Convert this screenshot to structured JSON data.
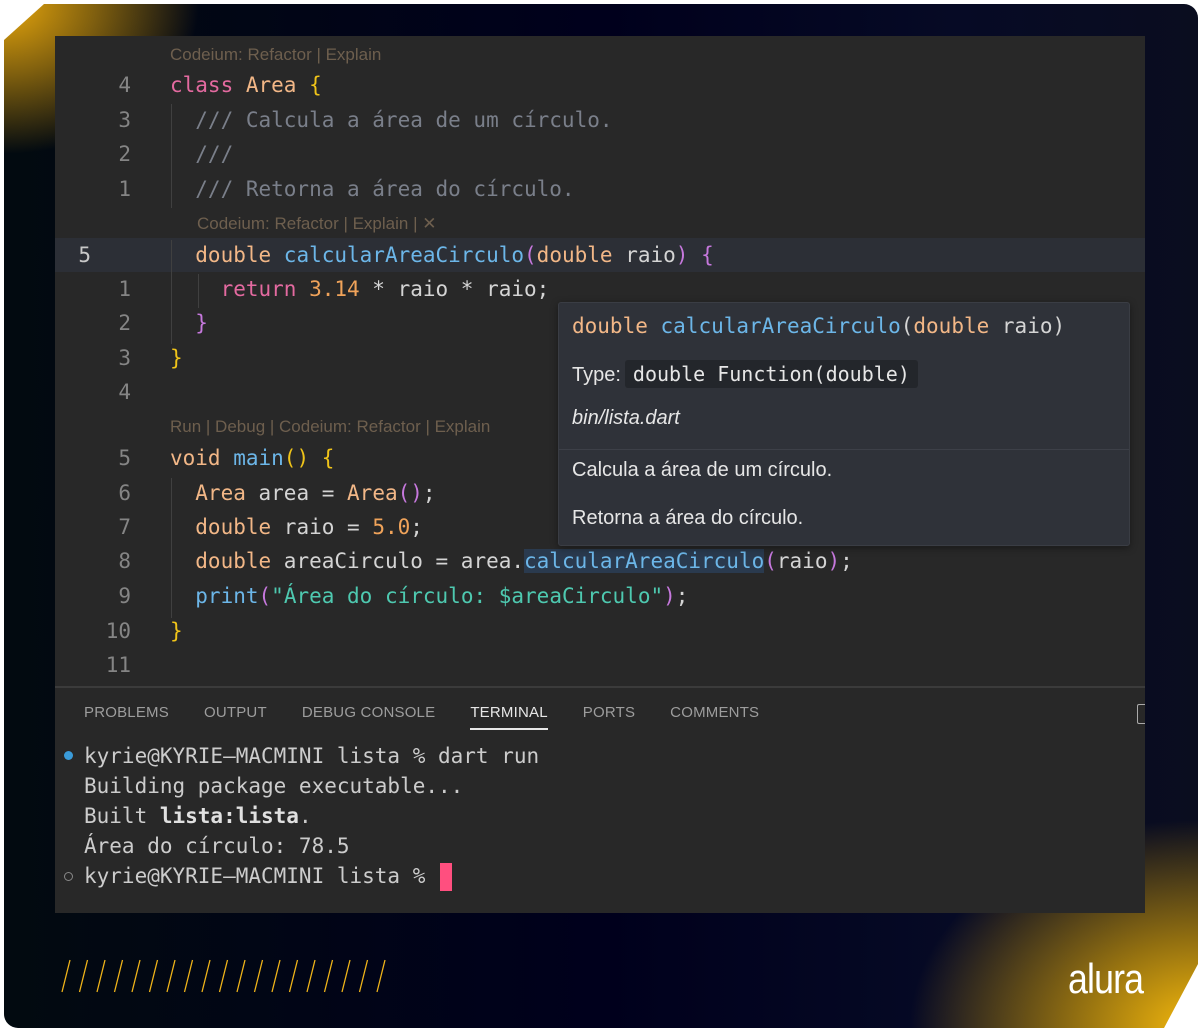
{
  "editor": {
    "codelens": {
      "class_lens": "Codeium: Refactor | Explain",
      "method_lens": "Codeium: Refactor | Explain | ✕",
      "main_lens": "Run | Debug | Codeium: Refactor | Explain"
    },
    "lines": [
      {
        "ln": "4",
        "tokens": [
          [
            "kw",
            "class "
          ],
          [
            "ty",
            "Area "
          ],
          [
            "br",
            "{"
          ]
        ]
      },
      {
        "ln": "3",
        "tokens": [
          [
            "cm",
            "  /// Calcula a área de um círculo."
          ]
        ]
      },
      {
        "ln": "2",
        "tokens": [
          [
            "cm",
            "  ///"
          ]
        ]
      },
      {
        "ln": "1",
        "tokens": [
          [
            "cm",
            "  /// Retorna a área do círculo."
          ]
        ]
      },
      {
        "ln": "5",
        "current": true,
        "tokens": [
          [
            "ty",
            "  double "
          ],
          [
            "fn",
            "calcularAreaCirculo"
          ],
          [
            "pa",
            "("
          ],
          [
            "ty",
            "double "
          ],
          [
            "tx",
            "raio"
          ],
          [
            "pa",
            ")"
          ],
          [
            "tx",
            " "
          ],
          [
            "pa",
            "{"
          ]
        ]
      },
      {
        "ln": "1",
        "tokens": [
          [
            "kw",
            "    return "
          ],
          [
            "nm",
            "3.14"
          ],
          [
            "tx",
            " * raio * raio;"
          ]
        ]
      },
      {
        "ln": "2",
        "tokens": [
          [
            "pa",
            "  }"
          ]
        ]
      },
      {
        "ln": "3",
        "tokens": [
          [
            "br",
            "}"
          ]
        ]
      },
      {
        "ln": "4",
        "tokens": []
      },
      {
        "ln": "5",
        "tokens": [
          [
            "ty",
            "void "
          ],
          [
            "fn",
            "main"
          ],
          [
            "br",
            "() {"
          ]
        ]
      },
      {
        "ln": "6",
        "tokens": [
          [
            "ty",
            "  Area "
          ],
          [
            "tx",
            "area = "
          ],
          [
            "ty",
            "Area"
          ],
          [
            "pa",
            "()"
          ],
          [
            "tx",
            ";"
          ]
        ]
      },
      {
        "ln": "7",
        "tokens": [
          [
            "ty",
            "  double "
          ],
          [
            "tx",
            "raio = "
          ],
          [
            "nm",
            "5.0"
          ],
          [
            "tx",
            ";"
          ]
        ]
      },
      {
        "ln": "8",
        "tokens": [
          [
            "ty",
            "  double "
          ],
          [
            "tx",
            "areaCirculo = area."
          ],
          [
            "fn",
            "calcularAreaCirculo"
          ],
          [
            "pa",
            "("
          ],
          [
            "tx",
            "raio"
          ],
          [
            "pa",
            ")"
          ],
          [
            "tx",
            ";"
          ]
        ]
      },
      {
        "ln": "9",
        "tokens": [
          [
            "fn",
            "  print"
          ],
          [
            "pa",
            "("
          ],
          [
            "st",
            "\"Área do círculo: $areaCirculo\""
          ],
          [
            "pa",
            ")"
          ],
          [
            "tx",
            ";"
          ]
        ]
      },
      {
        "ln": "10",
        "tokens": [
          [
            "br",
            "}"
          ]
        ]
      },
      {
        "ln": "11",
        "tokens": []
      }
    ]
  },
  "hover": {
    "signature": [
      [
        "ty",
        "double "
      ],
      [
        "fn",
        "calcularAreaCirculo"
      ],
      [
        "tx",
        "("
      ],
      [
        "ty",
        "double "
      ],
      [
        "tx",
        "raio)"
      ]
    ],
    "type_label": "Type:",
    "type_value": "double Function(double)",
    "file": "bin/lista.dart",
    "doc_line1": "Calcula a área de um círculo.",
    "doc_line2": "Retorna a área do círculo."
  },
  "panel": {
    "tabs": [
      "PROBLEMS",
      "OUTPUT",
      "DEBUG CONSOLE",
      "TERMINAL",
      "PORTS",
      "COMMENTS"
    ],
    "active_tab": "TERMINAL",
    "terminal": {
      "line1": "kyrie@KYRIE—MACMINI lista % dart run",
      "line2": "Building package executable...",
      "line3_prefix": "Built ",
      "line3_bold": "lista:lista",
      "line3_suffix": ".",
      "line4": "Área do círculo: 78.5",
      "line5": "kyrie@KYRIE—MACMINI lista % "
    },
    "colors": {
      "success_dot": "#3a9bd9",
      "cursor": "#ff4f7f"
    }
  },
  "brand": {
    "logo": "alura",
    "accent": "#f5b90c"
  }
}
